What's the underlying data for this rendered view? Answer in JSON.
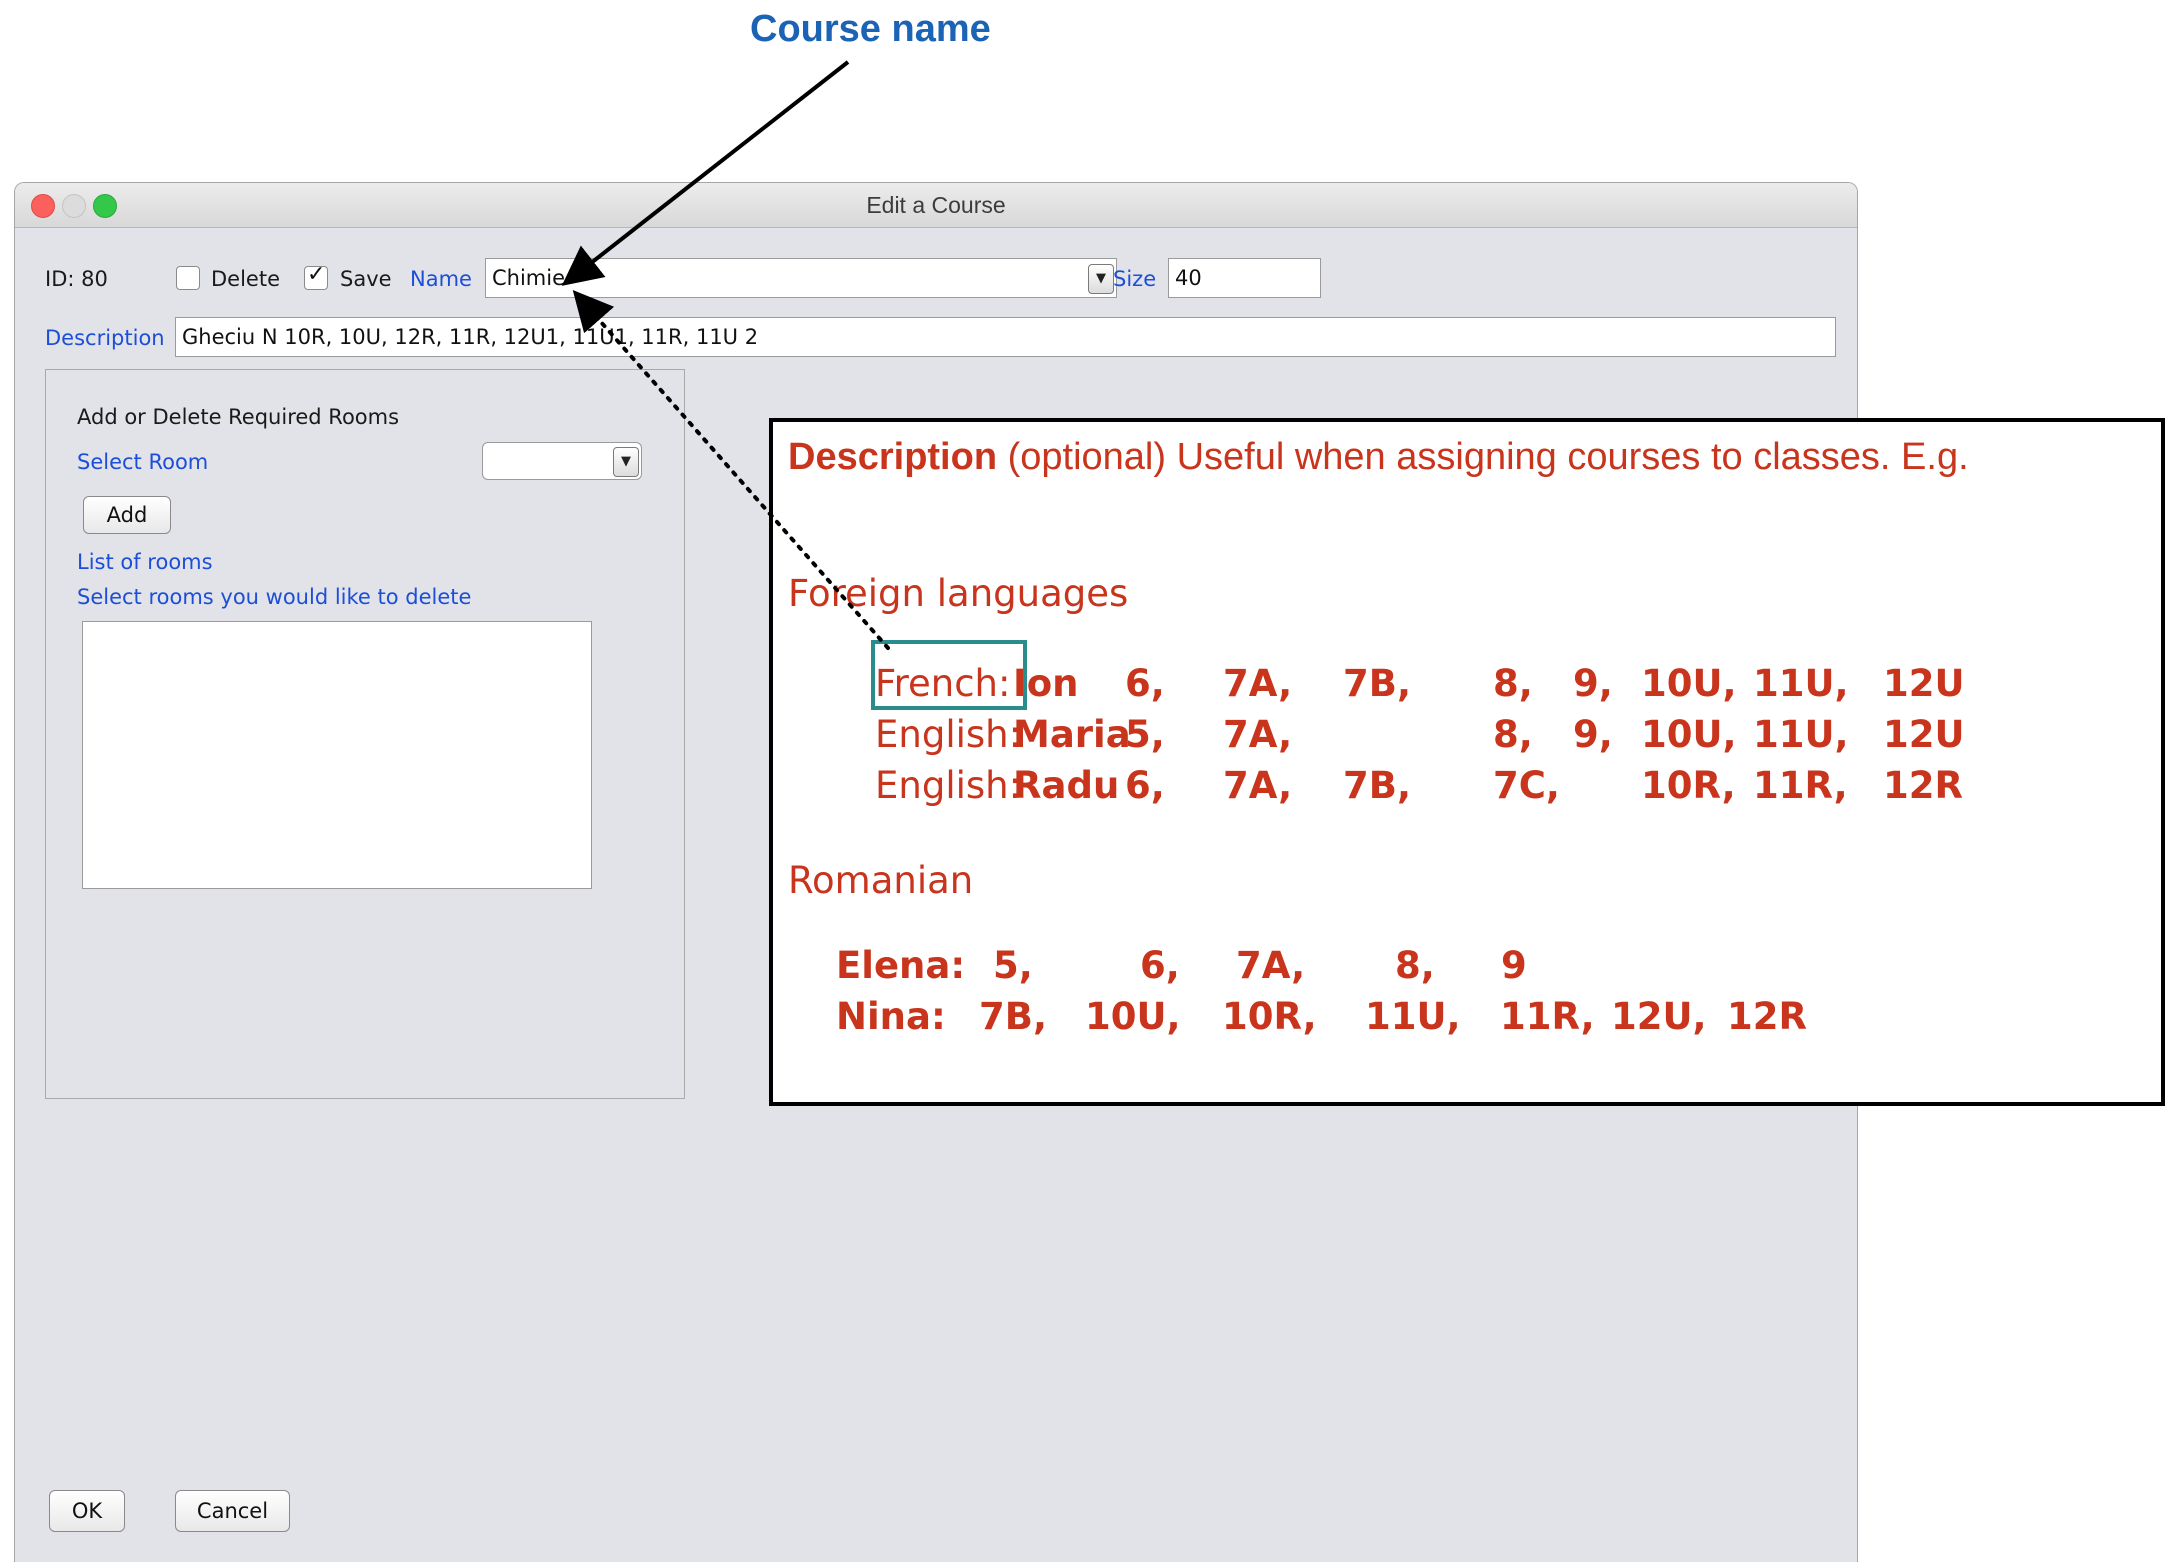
{
  "annotation": {
    "course_name_label": "Course name"
  },
  "window": {
    "title": "Edit a Course"
  },
  "form": {
    "id_label": "ID: 80",
    "delete_label": "Delete",
    "delete_checked": false,
    "save_label": "Save",
    "save_checked": true,
    "name_label": "Name",
    "name_value": "Chimie",
    "size_label": "Size",
    "size_value": "40",
    "description_label": "Description",
    "description_value": "Gheciu N 10R, 10U, 12R, 11R, 12U1, 11U1, 11R, 11U 2"
  },
  "rooms_panel": {
    "heading": "Add or Delete Required Rooms",
    "select_room_label": "Select Room",
    "select_room_value": "",
    "add_button": "Add",
    "list_label": "List of rooms",
    "list_hint": "Select rooms you would like to delete",
    "rooms": []
  },
  "buttons": {
    "ok": "OK",
    "cancel": "Cancel"
  },
  "help_box": {
    "title_bold": "Description",
    "title_rest": " (optional) Useful when assigning courses to classes. E.g.",
    "section_foreign": "Foreign languages",
    "foreign_rows": [
      {
        "lang": "French:",
        "teacher": "Ion",
        "cells": [
          "6,",
          "7A,",
          "7B,",
          "8,",
          "9,",
          "10U,",
          "11U,",
          "12U"
        ]
      },
      {
        "lang": "English:",
        "teacher": "Maria",
        "cells": [
          "5,",
          "7A,",
          "",
          "8,",
          "9,",
          "10U,",
          "11U,",
          "12U"
        ]
      },
      {
        "lang": "English:",
        "teacher": "Radu",
        "cells": [
          "6,",
          "7A,",
          "7B,",
          "7C,",
          "",
          "10R,",
          "11R,",
          "12R"
        ]
      }
    ],
    "section_romanian": "Romanian",
    "romanian_rows": [
      {
        "teacher": "Elena:",
        "cells": [
          "5,",
          "6,",
          "7A,",
          "8,",
          "9"
        ]
      },
      {
        "teacher": "Nina:",
        "cells": [
          "7B,",
          "10U,",
          "10R,",
          "11U,",
          "11R,",
          "12U,",
          "12R"
        ]
      }
    ]
  },
  "colors": {
    "accent_blue": "#1d4ed8",
    "annotation_blue": "#1a63b5",
    "help_red": "#c8341c",
    "highlight_teal": "#2a8c8c"
  }
}
